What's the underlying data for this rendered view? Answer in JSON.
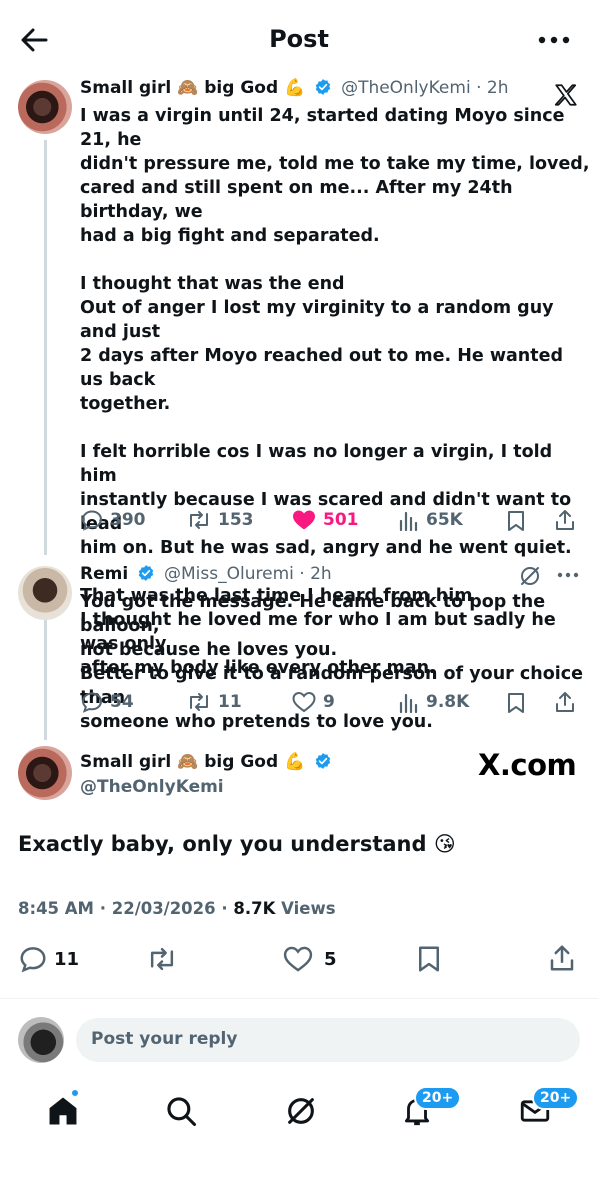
{
  "header": {
    "title": "Post"
  },
  "post1": {
    "author_name": "Small girl",
    "author_emoji_1": "🙈",
    "author_name_2": "big God",
    "author_emoji_2": "💪",
    "handle_time": "@TheOnlyKemi · 2h",
    "text": "I was a virgin until 24, started dating Moyo  since 21, he\ndidn't pressure me, told me to take my time, loved,\ncared and still spent on me... After my 24th birthday, we\nhad a big fight and separated.\n\nI thought that was the end\nOut of anger I lost my virginity to a random guy and just\n2 days after Moyo reached out to me. He wanted us back\ntogether.\n\nI felt horrible cos I was no longer a virgin, I told him\ninstantly because I was scared and didn't want to lead\nhim on. But he was sad, angry and he went quiet.\n\nThat was the last time I heard from him\nI thought he loved me for who I am but sadly he was only\nafter my body like every other man.",
    "replies": "390",
    "reposts": "153",
    "likes": "501",
    "views": "65K"
  },
  "post2": {
    "author_name": "Remi",
    "handle_time": "@Miss_Oluremi · 2h",
    "text": "You got the message. He came back to pop the balloon,\nnot because he loves you.\nBetter to give it to a random person of your choice than\nsomeone who pretends to love you.",
    "replies": "54",
    "reposts": "11",
    "likes": "9",
    "views": "9.8K"
  },
  "main_post": {
    "author_name": "Small girl",
    "author_emoji_1": "🙈",
    "author_name_2": "big God",
    "author_emoji_2": "💪",
    "handle": "@TheOnlyKemi",
    "watermark": "X.com",
    "text": "Exactly baby, only you understand",
    "text_emoji": "😘",
    "time_date": "8:45 AM · 22/03/2026 · ",
    "views_count": "8.7K",
    "views_label": " Views",
    "replies": "11",
    "likes": "5"
  },
  "reply": {
    "placeholder": "Post your reply"
  },
  "bottom_nav": {
    "notifications_badge": "20+",
    "messages_badge": "20+"
  },
  "colors": {
    "accent": "#1d9bf0",
    "like": "#f91880",
    "secondary_text": "#536471"
  }
}
